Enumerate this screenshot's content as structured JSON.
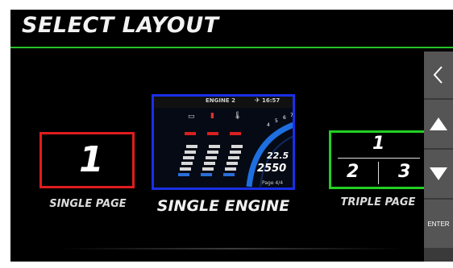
{
  "header": {
    "title": "SELECT LAYOUT"
  },
  "layouts": {
    "single_page": {
      "number": "1",
      "label": "SINGLE PAGE"
    },
    "single_engine": {
      "label": "SINGLE ENGINE",
      "preview": {
        "title": "ENGINE 2",
        "time": "16:57",
        "value1": "22.5",
        "value2": "2550",
        "page": "Page 4/4",
        "gauge_ticks": [
          "4",
          "5",
          "6",
          "7"
        ]
      }
    },
    "triple_page": {
      "numbers": [
        "1",
        "2",
        "3"
      ],
      "label": "TRIPLE PAGE"
    }
  },
  "side_buttons": {
    "back_icon": "chevron-left-icon",
    "up_icon": "triangle-up-icon",
    "down_icon": "triangle-down-icon",
    "enter_label": "ENTER"
  },
  "colors": {
    "single_page_border": "#e01c1c",
    "single_engine_border": "#1a2fe6",
    "triple_page_border": "#22d022",
    "title_underline": "#27c227"
  }
}
